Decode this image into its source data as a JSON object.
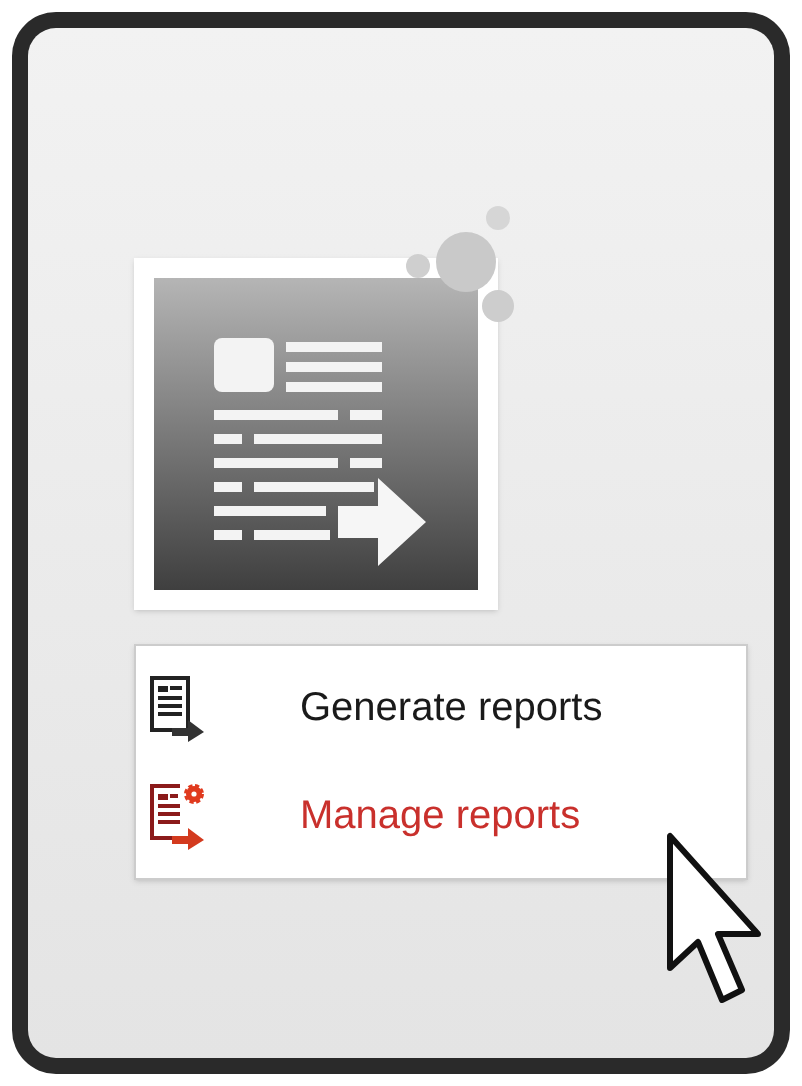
{
  "menu": {
    "items": [
      {
        "label": "Generate reports",
        "kind": "generate",
        "selected": false
      },
      {
        "label": "Manage reports",
        "kind": "manage",
        "selected": true
      }
    ]
  }
}
